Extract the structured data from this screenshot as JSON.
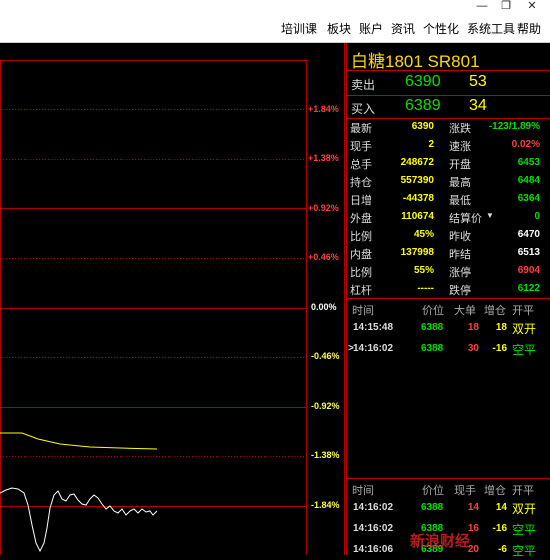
{
  "menu": [
    "培训课",
    "板块",
    "账户",
    "资讯",
    "个性化",
    "系统工具",
    "帮助"
  ],
  "window_icons": [
    "minimize-icon",
    "restore-icon",
    "close-icon"
  ],
  "chart": {
    "y_labels": [
      "+1.84%",
      "+1.38%",
      "+0.92%",
      "+0.46%",
      "0.00%",
      "-0.46%",
      "-0.92%",
      "-1.38%",
      "-1.84%"
    ],
    "colors": {
      "up": "#ff4040",
      "zero": "#ffffff",
      "down": "#ffff40",
      "grid": "#b00000",
      "avg_line": "#ffff00",
      "price_line": "#ffffff"
    }
  },
  "panel": {
    "title": "白糖1801  SR801",
    "sell": {
      "label": "卖出",
      "price": "6390",
      "volume": "53"
    },
    "buy": {
      "label": "买入",
      "price": "6389",
      "volume": "34"
    },
    "fields_left": [
      {
        "label": "最新",
        "value": "6390",
        "color": "#ffff00"
      },
      {
        "label": "现手",
        "value": "2",
        "color": "#ffff00"
      },
      {
        "label": "总手",
        "value": "248672",
        "color": "#ffff00"
      },
      {
        "label": "持仓",
        "value": "557390",
        "color": "#ffff00"
      },
      {
        "label": "日增",
        "value": "-44378",
        "color": "#ffff00"
      },
      {
        "label": "外盘",
        "value": "110674",
        "color": "#ffff00"
      },
      {
        "label": "比例",
        "value": "45%",
        "color": "#ffff00"
      },
      {
        "label": "内盘",
        "value": "137998",
        "color": "#ffff00"
      },
      {
        "label": "比例",
        "value": "55%",
        "color": "#ffff00"
      },
      {
        "label": "杠杆",
        "value": "-----",
        "color": "#ffff00"
      }
    ],
    "fields_right": [
      {
        "label": "涨跌",
        "value": "-123/1.89%",
        "color": "#00e000"
      },
      {
        "label": "速涨",
        "value": "0.02%",
        "color": "#ff4040"
      },
      {
        "label": "开盘",
        "value": "6453",
        "color": "#00e000"
      },
      {
        "label": "最高",
        "value": "6484",
        "color": "#00e000"
      },
      {
        "label": "最低",
        "value": "6364",
        "color": "#00e000"
      },
      {
        "label": "结算价",
        "value": "0",
        "color": "#00e000"
      },
      {
        "label": "昨收",
        "value": "6470",
        "color": "#ffffff"
      },
      {
        "label": "昨结",
        "value": "6513",
        "color": "#ffffff"
      },
      {
        "label": "涨停",
        "value": "6904",
        "color": "#ff4040"
      },
      {
        "label": "跌停",
        "value": "6122",
        "color": "#00e000"
      }
    ],
    "big_orders": {
      "headers": [
        "时间",
        "价位",
        "大单",
        "增仓",
        "开平"
      ],
      "rows": [
        {
          "marker": "",
          "time": "14:15:48",
          "price": "6388",
          "qty": "18",
          "chg": "18",
          "type": "双开",
          "qty_color": "#ff4040",
          "chg_color": "#ffff00",
          "type_color": "#ffff00"
        },
        {
          "marker": ">",
          "time": "14:16:02",
          "price": "6388",
          "qty": "30",
          "chg": "-16",
          "type": "空平",
          "qty_color": "#ff4040",
          "chg_color": "#ffff00",
          "type_color": "#00e000"
        }
      ]
    },
    "ticks": {
      "headers": [
        "时间",
        "价位",
        "现手",
        "增仓",
        "开平"
      ],
      "rows": [
        {
          "time": "14:16:02",
          "price": "6388",
          "qty": "14",
          "chg": "14",
          "type": "双开",
          "qty_color": "#ff4040",
          "chg_color": "#ffff00",
          "type_color": "#ffff00"
        },
        {
          "time": "14:16:02",
          "price": "6388",
          "qty": "16",
          "chg": "-16",
          "type": "空平",
          "qty_color": "#ff4040",
          "chg_color": "#ffff00",
          "type_color": "#00e000"
        },
        {
          "time": "14:16:06",
          "price": "6389",
          "qty": "20",
          "chg": "-6",
          "type": "空平",
          "qty_color": "#ff4040",
          "chg_color": "#ffff00",
          "type_color": "#00e000"
        }
      ]
    }
  },
  "watermark": "新浪财经"
}
